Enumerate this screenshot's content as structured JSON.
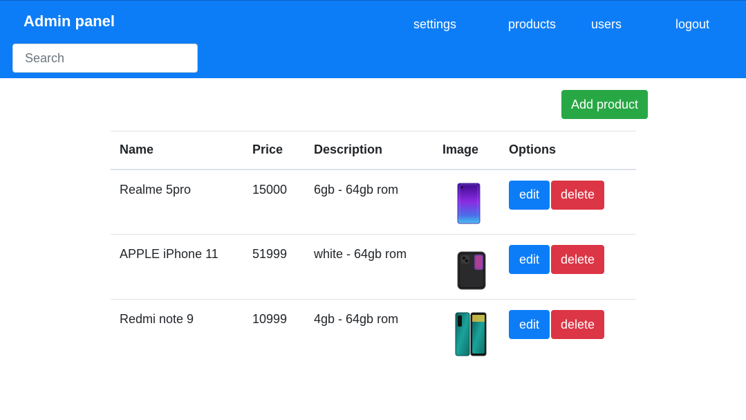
{
  "navbar": {
    "brand": "Admin panel",
    "links": [
      "settings",
      "products",
      "users",
      "logout"
    ],
    "search_placeholder": "Search",
    "color": "#0d7df7"
  },
  "toolbar": {
    "add_label": "Add product",
    "add_color": "#28a745"
  },
  "table": {
    "headers": [
      "Name",
      "Price",
      "Description",
      "Image",
      "Options"
    ],
    "rows": [
      {
        "name": "Realme 5pro",
        "price": "15000",
        "description": "6gb - 64gb rom",
        "image": "phone-purple-gradient",
        "edit": "edit",
        "delete": "delete"
      },
      {
        "name": "APPLE iPhone 11",
        "price": "51999",
        "description": "white - 64gb rom",
        "image": "phone-black",
        "edit": "edit",
        "delete": "delete"
      },
      {
        "name": "Redmi note 9",
        "price": "10999",
        "description": "4gb - 64gb rom",
        "image": "phone-green",
        "edit": "edit",
        "delete": "delete"
      }
    ]
  },
  "colors": {
    "edit": "#0d7df7",
    "delete": "#dc3545"
  }
}
